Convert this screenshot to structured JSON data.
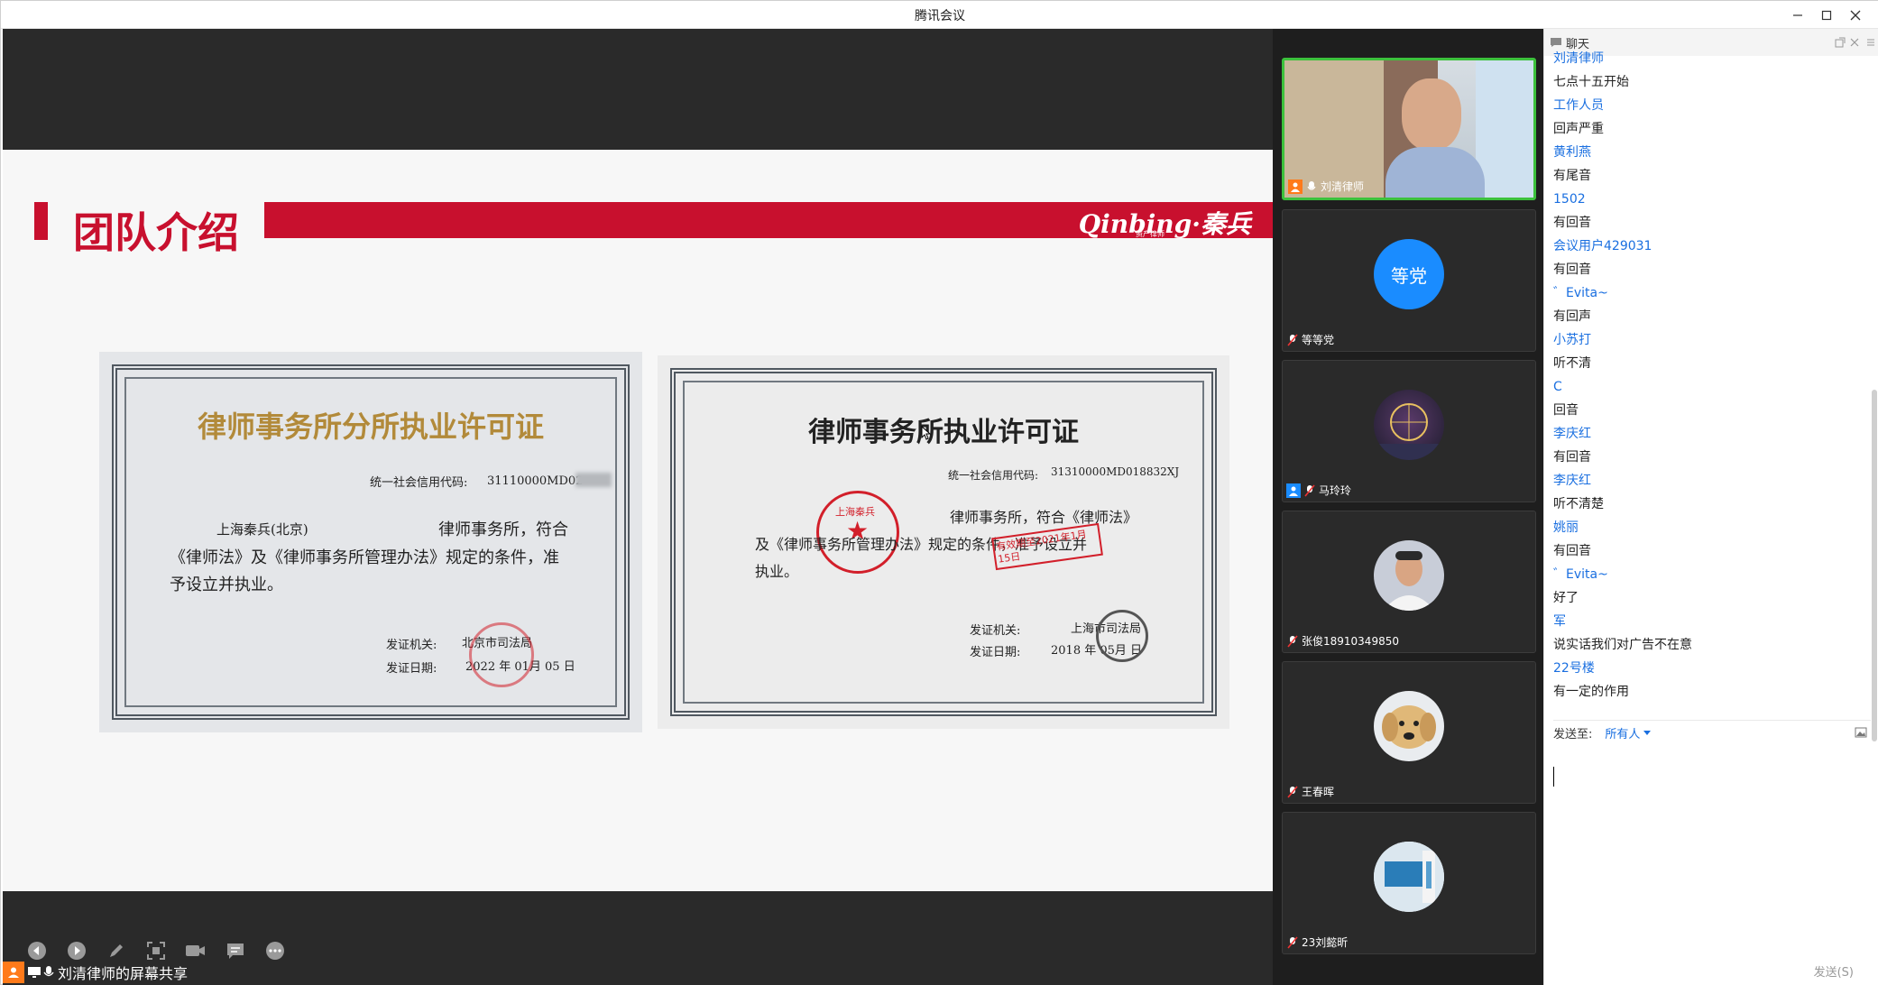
{
  "window": {
    "title": "腾讯会议"
  },
  "slide": {
    "title": "团队介绍",
    "logo": "Qinbing·秦兵",
    "logo_sub": "资产律师",
    "cert_left": {
      "heading": "律师事务所分所执业许可证",
      "code_label": "统一社会信用代码:",
      "code_value": "31110000MD02",
      "firm": "上海秦兵(北京)",
      "line1": "律师事务所，符合",
      "line2": "《律师法》及《律师事务所管理办法》规定的条件，准",
      "line3": "予设立并执业。",
      "issuer_label": "发证机关:",
      "issuer": "北京市司法局",
      "date_label": "发证日期:",
      "date": "2022  年  01月 05  日"
    },
    "cert_right": {
      "heading": "律师事务所执业许可证",
      "code_label": "统一社会信用代码:",
      "code_value": "31310000MD018832XJ",
      "seal_text": "上海秦兵",
      "line1": "律师事务所，符合《律师法》",
      "line2": "及《律师事务所管理办法》规定的条件，准予设立并",
      "line3": "执业。",
      "stamp": "有效期至2021年1月15日",
      "issuer_label": "发证机关:",
      "issuer": "上海市司法局",
      "date_label": "发证日期:",
      "date": "2018 年 05月   日"
    }
  },
  "toolbar": {
    "icons": [
      "prev-icon",
      "next-icon",
      "pen-icon",
      "fullscreen-icon",
      "camera-icon",
      "chat-icon",
      "more-icon"
    ]
  },
  "sharer": {
    "label": "刘清律师的屏幕共享"
  },
  "participants": [
    {
      "name": "刘清律师",
      "active": true,
      "kind": "video"
    },
    {
      "name": "等等党",
      "avatar_text": "等党",
      "kind": "text"
    },
    {
      "name": "马玲玲",
      "kind": "image-ferris"
    },
    {
      "name": "张俊18910349850",
      "kind": "image-man"
    },
    {
      "name": "王春晖",
      "kind": "image-dog"
    },
    {
      "name": "23刘懿昕",
      "kind": "image-sign"
    }
  ],
  "chat": {
    "title": "聊天",
    "messages": [
      {
        "text": "刘清律师",
        "type": "name"
      },
      {
        "text": "七点十五开始",
        "type": "text"
      },
      {
        "text": "工作人员",
        "type": "name"
      },
      {
        "text": "回声严重",
        "type": "text"
      },
      {
        "text": "黄利燕",
        "type": "name"
      },
      {
        "text": "有尾音",
        "type": "text"
      },
      {
        "text": "1502",
        "type": "name"
      },
      {
        "text": "有回音",
        "type": "text"
      },
      {
        "text": "会议用户429031",
        "type": "name"
      },
      {
        "text": "有回音",
        "type": "text"
      },
      {
        "text": "゛Evita~",
        "type": "name"
      },
      {
        "text": "有回声",
        "type": "text"
      },
      {
        "text": "小苏打",
        "type": "name"
      },
      {
        "text": "听不清",
        "type": "text"
      },
      {
        "text": "C",
        "type": "name"
      },
      {
        "text": "回音",
        "type": "text"
      },
      {
        "text": "李庆红",
        "type": "name"
      },
      {
        "text": "有回音",
        "type": "text"
      },
      {
        "text": "李庆红",
        "type": "name"
      },
      {
        "text": "听不清楚",
        "type": "text"
      },
      {
        "text": "姚丽",
        "type": "name"
      },
      {
        "text": "有回音",
        "type": "text"
      },
      {
        "text": "゛Evita~",
        "type": "name"
      },
      {
        "text": "好了",
        "type": "text"
      },
      {
        "text": "军",
        "type": "name"
      },
      {
        "text": "说实话我们对广告不在意",
        "type": "text"
      },
      {
        "text": "22号楼",
        "type": "name"
      },
      {
        "text": "有一定的作用",
        "type": "text"
      }
    ],
    "send_to_label": "发送至:",
    "send_to_target": "所有人",
    "send_button": "发送(S)"
  },
  "colors": {
    "accent_red": "#c8102e",
    "chat_name": "#1a6fe0",
    "active_border": "#3cc13c"
  }
}
